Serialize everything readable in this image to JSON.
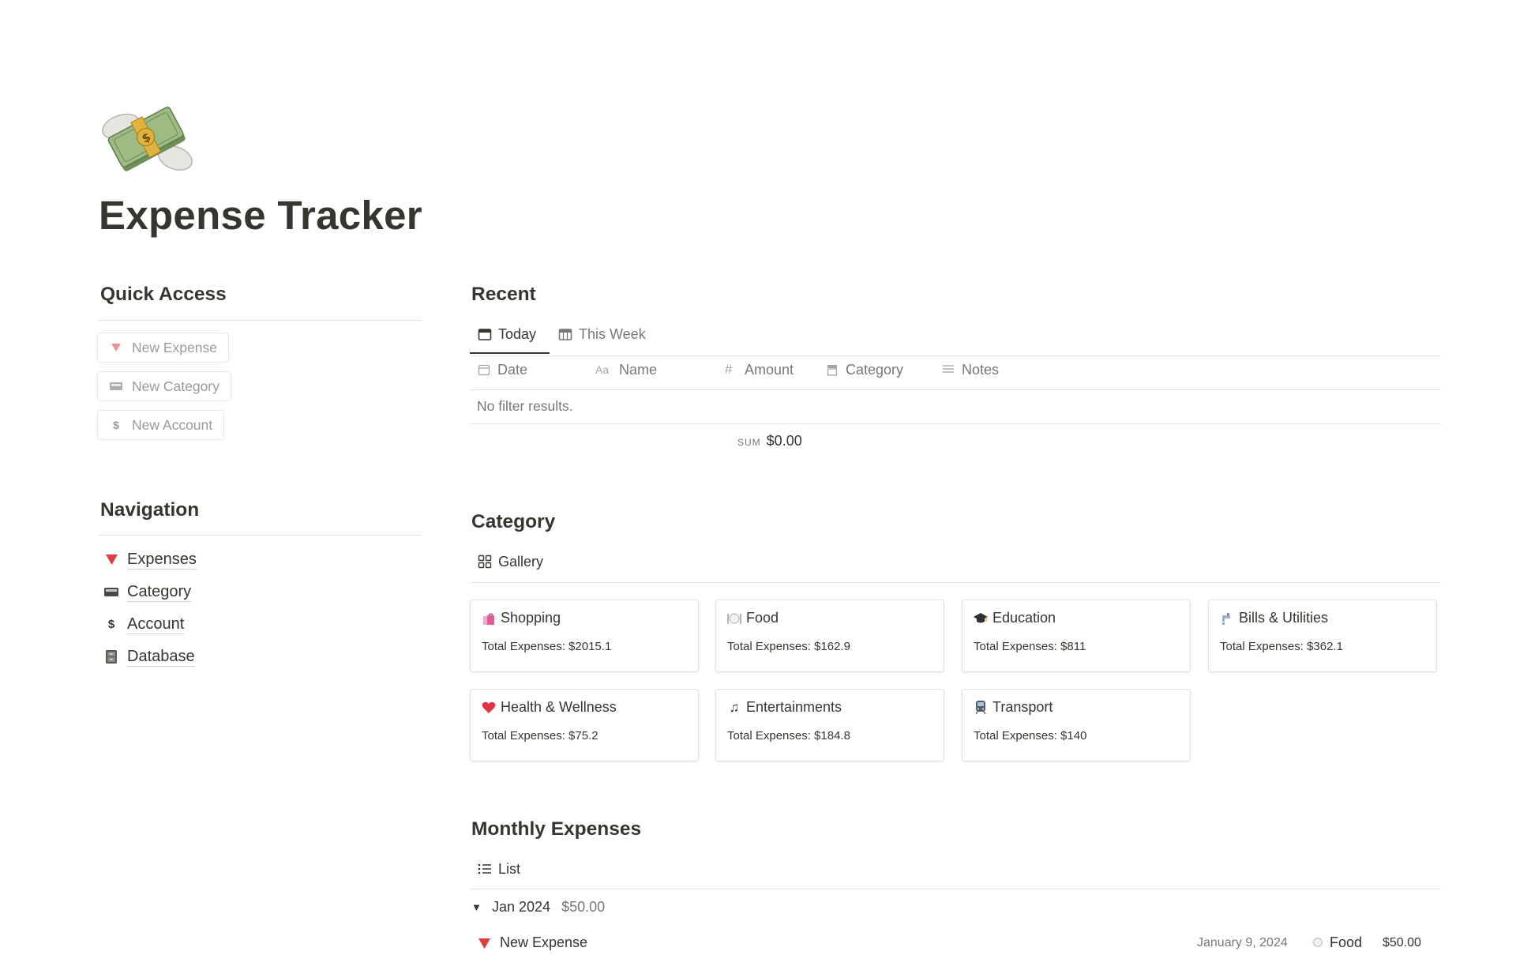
{
  "page": {
    "title": "Expense Tracker",
    "icon": "money-with-wings-icon"
  },
  "quick_access": {
    "heading": "Quick Access",
    "buttons": [
      {
        "label": "New Expense",
        "icon": "red-triangle-icon"
      },
      {
        "label": "New Category",
        "icon": "card-index-icon"
      },
      {
        "label": "New Account",
        "icon": "currency-exchange-icon"
      }
    ]
  },
  "navigation": {
    "heading": "Navigation",
    "items": [
      {
        "label": "Expenses",
        "icon": "red-triangle-icon"
      },
      {
        "label": "Category",
        "icon": "card-index-icon"
      },
      {
        "label": "Account",
        "icon": "currency-exchange-icon"
      },
      {
        "label": "Database",
        "icon": "file-cabinet-icon"
      }
    ]
  },
  "recent": {
    "heading": "Recent",
    "tabs": [
      {
        "label": "Today",
        "icon": "calendar-icon",
        "active": true
      },
      {
        "label": "This Week",
        "icon": "calendar-week-icon",
        "active": false
      }
    ],
    "columns": [
      {
        "label": "Date",
        "icon": "calendar-icon"
      },
      {
        "label": "Name",
        "icon": "text-aa-icon"
      },
      {
        "label": "Amount",
        "icon": "hash-icon"
      },
      {
        "label": "Category",
        "icon": "archive-icon"
      },
      {
        "label": "Notes",
        "icon": "lines-icon"
      }
    ],
    "empty_text": "No filter results.",
    "sum_label": "SUM",
    "sum_value": "$0.00"
  },
  "category": {
    "heading": "Category",
    "view_label": "Gallery",
    "cards": [
      {
        "title": "Shopping",
        "icon": "shopping-bags-icon",
        "total": "Total Expenses: $2015.1"
      },
      {
        "title": "Food",
        "icon": "fork-knife-plate-icon",
        "total": "Total Expenses: $162.9"
      },
      {
        "title": "Education",
        "icon": "graduation-cap-icon",
        "total": "Total Expenses: $811"
      },
      {
        "title": "Bills & Utilities",
        "icon": "faucet-icon",
        "total": "Total Expenses: $362.1"
      },
      {
        "title": "Health & Wellness",
        "icon": "heart-icon",
        "total": "Total Expenses: $75.2"
      },
      {
        "title": "Entertainments",
        "icon": "musical-notes-icon",
        "total": "Total Expenses: $184.8"
      },
      {
        "title": "Transport",
        "icon": "train-icon",
        "total": "Total Expenses: $140"
      }
    ]
  },
  "monthly": {
    "heading": "Monthly Expenses",
    "view_label": "List",
    "group": {
      "label": "Jan 2024",
      "total": "$50.00"
    },
    "rows": [
      {
        "name": "New Expense",
        "date": "January 9, 2024",
        "category": "Food",
        "amount": "$50.00"
      }
    ]
  },
  "colors": {
    "text": "#37352f",
    "muted": "#787774",
    "border": "#e3e2e0",
    "red": "#e03e3e"
  }
}
